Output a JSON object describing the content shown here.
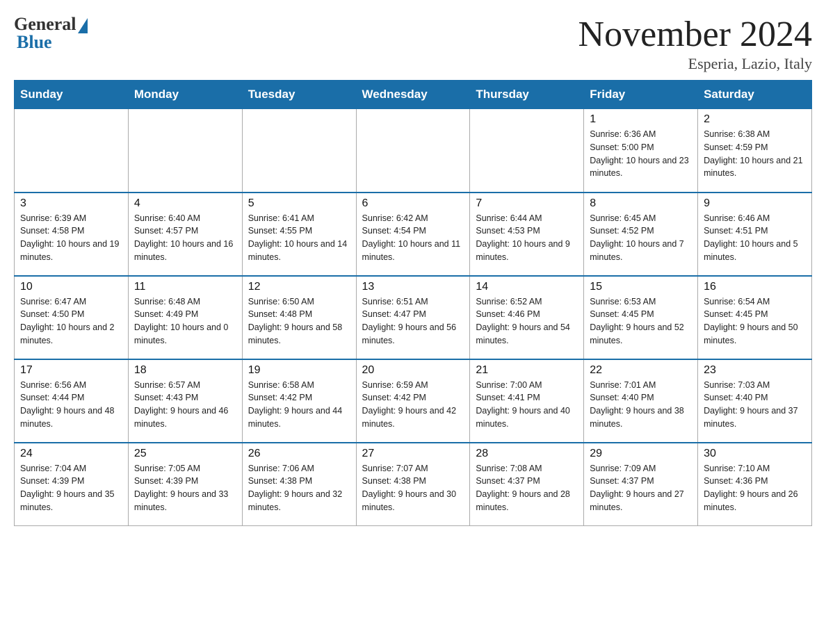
{
  "logo": {
    "general": "General",
    "blue": "Blue"
  },
  "title": "November 2024",
  "subtitle": "Esperia, Lazio, Italy",
  "weekdays": [
    "Sunday",
    "Monday",
    "Tuesday",
    "Wednesday",
    "Thursday",
    "Friday",
    "Saturday"
  ],
  "weeks": [
    [
      {
        "day": "",
        "info": ""
      },
      {
        "day": "",
        "info": ""
      },
      {
        "day": "",
        "info": ""
      },
      {
        "day": "",
        "info": ""
      },
      {
        "day": "",
        "info": ""
      },
      {
        "day": "1",
        "info": "Sunrise: 6:36 AM\nSunset: 5:00 PM\nDaylight: 10 hours and 23 minutes."
      },
      {
        "day": "2",
        "info": "Sunrise: 6:38 AM\nSunset: 4:59 PM\nDaylight: 10 hours and 21 minutes."
      }
    ],
    [
      {
        "day": "3",
        "info": "Sunrise: 6:39 AM\nSunset: 4:58 PM\nDaylight: 10 hours and 19 minutes."
      },
      {
        "day": "4",
        "info": "Sunrise: 6:40 AM\nSunset: 4:57 PM\nDaylight: 10 hours and 16 minutes."
      },
      {
        "day": "5",
        "info": "Sunrise: 6:41 AM\nSunset: 4:55 PM\nDaylight: 10 hours and 14 minutes."
      },
      {
        "day": "6",
        "info": "Sunrise: 6:42 AM\nSunset: 4:54 PM\nDaylight: 10 hours and 11 minutes."
      },
      {
        "day": "7",
        "info": "Sunrise: 6:44 AM\nSunset: 4:53 PM\nDaylight: 10 hours and 9 minutes."
      },
      {
        "day": "8",
        "info": "Sunrise: 6:45 AM\nSunset: 4:52 PM\nDaylight: 10 hours and 7 minutes."
      },
      {
        "day": "9",
        "info": "Sunrise: 6:46 AM\nSunset: 4:51 PM\nDaylight: 10 hours and 5 minutes."
      }
    ],
    [
      {
        "day": "10",
        "info": "Sunrise: 6:47 AM\nSunset: 4:50 PM\nDaylight: 10 hours and 2 minutes."
      },
      {
        "day": "11",
        "info": "Sunrise: 6:48 AM\nSunset: 4:49 PM\nDaylight: 10 hours and 0 minutes."
      },
      {
        "day": "12",
        "info": "Sunrise: 6:50 AM\nSunset: 4:48 PM\nDaylight: 9 hours and 58 minutes."
      },
      {
        "day": "13",
        "info": "Sunrise: 6:51 AM\nSunset: 4:47 PM\nDaylight: 9 hours and 56 minutes."
      },
      {
        "day": "14",
        "info": "Sunrise: 6:52 AM\nSunset: 4:46 PM\nDaylight: 9 hours and 54 minutes."
      },
      {
        "day": "15",
        "info": "Sunrise: 6:53 AM\nSunset: 4:45 PM\nDaylight: 9 hours and 52 minutes."
      },
      {
        "day": "16",
        "info": "Sunrise: 6:54 AM\nSunset: 4:45 PM\nDaylight: 9 hours and 50 minutes."
      }
    ],
    [
      {
        "day": "17",
        "info": "Sunrise: 6:56 AM\nSunset: 4:44 PM\nDaylight: 9 hours and 48 minutes."
      },
      {
        "day": "18",
        "info": "Sunrise: 6:57 AM\nSunset: 4:43 PM\nDaylight: 9 hours and 46 minutes."
      },
      {
        "day": "19",
        "info": "Sunrise: 6:58 AM\nSunset: 4:42 PM\nDaylight: 9 hours and 44 minutes."
      },
      {
        "day": "20",
        "info": "Sunrise: 6:59 AM\nSunset: 4:42 PM\nDaylight: 9 hours and 42 minutes."
      },
      {
        "day": "21",
        "info": "Sunrise: 7:00 AM\nSunset: 4:41 PM\nDaylight: 9 hours and 40 minutes."
      },
      {
        "day": "22",
        "info": "Sunrise: 7:01 AM\nSunset: 4:40 PM\nDaylight: 9 hours and 38 minutes."
      },
      {
        "day": "23",
        "info": "Sunrise: 7:03 AM\nSunset: 4:40 PM\nDaylight: 9 hours and 37 minutes."
      }
    ],
    [
      {
        "day": "24",
        "info": "Sunrise: 7:04 AM\nSunset: 4:39 PM\nDaylight: 9 hours and 35 minutes."
      },
      {
        "day": "25",
        "info": "Sunrise: 7:05 AM\nSunset: 4:39 PM\nDaylight: 9 hours and 33 minutes."
      },
      {
        "day": "26",
        "info": "Sunrise: 7:06 AM\nSunset: 4:38 PM\nDaylight: 9 hours and 32 minutes."
      },
      {
        "day": "27",
        "info": "Sunrise: 7:07 AM\nSunset: 4:38 PM\nDaylight: 9 hours and 30 minutes."
      },
      {
        "day": "28",
        "info": "Sunrise: 7:08 AM\nSunset: 4:37 PM\nDaylight: 9 hours and 28 minutes."
      },
      {
        "day": "29",
        "info": "Sunrise: 7:09 AM\nSunset: 4:37 PM\nDaylight: 9 hours and 27 minutes."
      },
      {
        "day": "30",
        "info": "Sunrise: 7:10 AM\nSunset: 4:36 PM\nDaylight: 9 hours and 26 minutes."
      }
    ]
  ]
}
